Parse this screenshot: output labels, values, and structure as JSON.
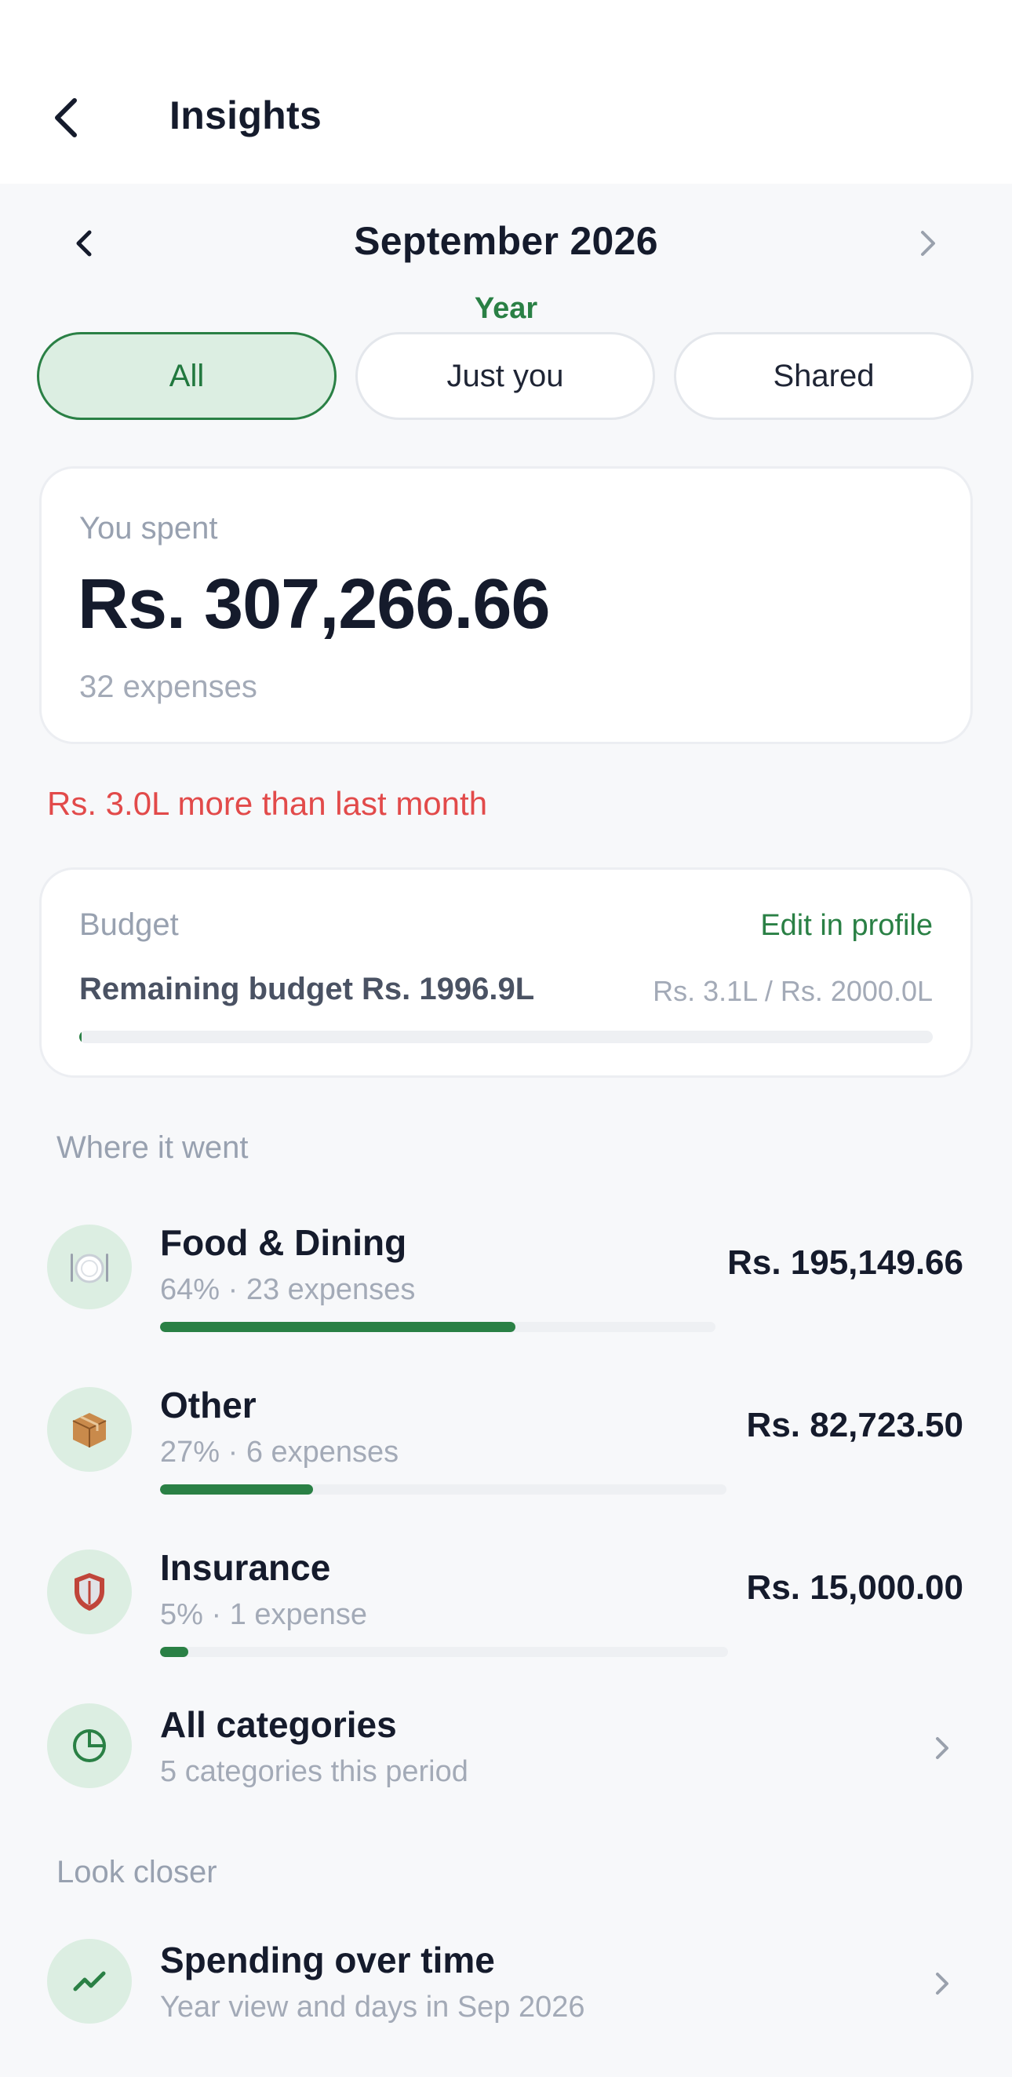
{
  "header": {
    "title": "Insights",
    "back_icon": "chevron-left-icon"
  },
  "period": {
    "label": "September 2026",
    "mode": "Year",
    "prev_icon": "chevron-left-icon",
    "next_icon": "chevron-right-icon"
  },
  "filters": [
    {
      "label": "All",
      "active": true
    },
    {
      "label": "Just you",
      "active": false
    },
    {
      "label": "Shared",
      "active": false
    }
  ],
  "summary": {
    "label": "You spent",
    "amount": "Rs. 307,266.66",
    "count": "32 expenses"
  },
  "comparison": "Rs. 3.0L more than last month",
  "budget": {
    "title": "Budget",
    "edit_label": "Edit in profile",
    "remaining": "Remaining budget Rs. 1996.9L",
    "ratio": "Rs. 3.1L / Rs. 2000.0L",
    "used_fraction": 0.0016
  },
  "where": {
    "title": "Where it went",
    "categories": [
      {
        "name": "Food & Dining",
        "meta": "64%  ·  23 expenses",
        "amount": "Rs. 195,149.66",
        "share": 0.64,
        "icon": "plate-icon"
      },
      {
        "name": "Other",
        "meta": "27%  ·  6 expenses",
        "amount": "Rs. 82,723.50",
        "share": 0.27,
        "icon": "package-icon"
      },
      {
        "name": "Insurance",
        "meta": "5%  ·  1 expense",
        "amount": "Rs. 15,000.00",
        "share": 0.05,
        "icon": "shield-icon"
      }
    ],
    "all": {
      "title": "All categories",
      "subtitle": "5 categories this period",
      "icon": "pie-chart-icon"
    }
  },
  "closer": {
    "title": "Look closer",
    "spending": {
      "title": "Spending over time",
      "subtitle": "Year view and days in Sep 2026",
      "icon": "trend-icon"
    }
  },
  "colors": {
    "accent": "#2a8045",
    "accent_bg": "#dceee2",
    "negative": "#e24a4a",
    "background": "#f7f8fa"
  }
}
